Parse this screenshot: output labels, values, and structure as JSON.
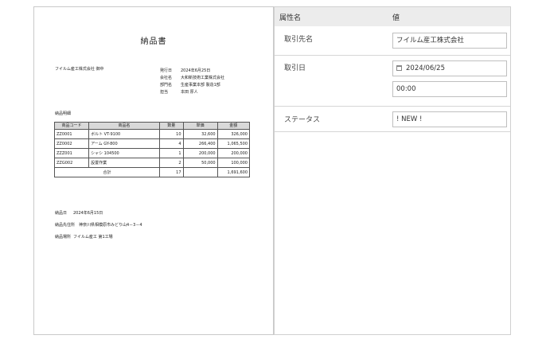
{
  "document": {
    "title": "納品書",
    "company": "フイルム産工株式会社 御中",
    "meta": [
      {
        "label": "発行日",
        "value": "2024年6月25日"
      },
      {
        "label": "会社名",
        "value": "大和新技術工業株式会社"
      },
      {
        "label": "部門名",
        "value": "生産事業本部 製造1部"
      },
      {
        "label": "担当",
        "value": "本田 厚人"
      }
    ],
    "detail_heading": "納品明細",
    "table": {
      "headers": [
        "商品コード",
        "商品名",
        "数量",
        "単価",
        "金額"
      ],
      "rows": [
        [
          "ZZ0001",
          "ボルト VT-9100",
          "10",
          "32,600",
          "326,000"
        ],
        [
          "ZZ0002",
          "アーム GY-800",
          "4",
          "266,400",
          "1,065,500"
        ],
        [
          "ZZZ001",
          "シャシ 104500",
          "1",
          "200,000",
          "200,000"
        ],
        [
          "ZZG002",
          "設置作業",
          "2",
          "50,000",
          "100,000"
        ]
      ],
      "total": {
        "label": "合計",
        "qty": "17",
        "price": "",
        "amount": "1,691,600"
      }
    },
    "footer": [
      {
        "label": "納品日",
        "value": "2024年6月15日"
      },
      {
        "label": "納品先住所",
        "value": "神奈川県相模原市みどり山4－3－4"
      },
      {
        "label": "納品場所",
        "value": "フイルム産工 第1工場"
      }
    ]
  },
  "panel": {
    "header_name": "属性名",
    "header_value": "値",
    "properties": {
      "partner": {
        "label": "取引先名",
        "value": "フイルム産工株式会社"
      },
      "trade_date": {
        "label": "取引日",
        "date": "2024/06/25",
        "time": "00:00"
      },
      "status": {
        "label": "ステータス",
        "value": "! NEW !"
      }
    }
  }
}
